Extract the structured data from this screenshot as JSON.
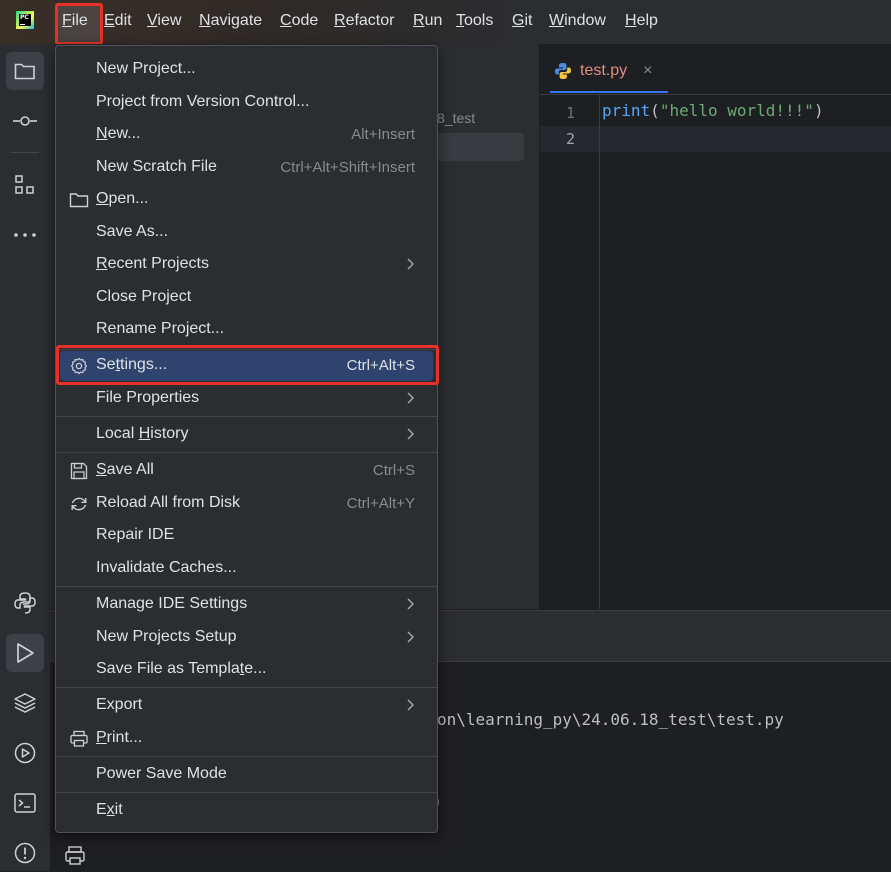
{
  "menubar": {
    "items": [
      "File",
      "Edit",
      "View",
      "Navigate",
      "Code",
      "Refactor",
      "Run",
      "Tools",
      "Git",
      "Window",
      "Help"
    ]
  },
  "project_panel": {
    "peek_text": "8_test"
  },
  "editor": {
    "tab_label": "test.py",
    "tab_close": "×",
    "line_numbers": [
      "1",
      "2"
    ],
    "code_line_1": {
      "fn": "print",
      "open": "(",
      "str": "\"hello world!!!\"",
      "close": ")"
    }
  },
  "console": {
    "path_line": "on\\learning_py\\24.06.18_test\\test.py",
    "exit_fragment": "0"
  },
  "file_menu": {
    "items": [
      {
        "label_pre": "New Project...",
        "label_u": "",
        "label_post": "",
        "shortcut": "",
        "submenu": false,
        "icon": ""
      },
      {
        "label_pre": "Project from Version Control...",
        "label_u": "",
        "label_post": "",
        "shortcut": "",
        "submenu": false,
        "icon": ""
      },
      {
        "label_pre": "",
        "label_u": "N",
        "label_post": "ew...",
        "shortcut": "Alt+Insert",
        "submenu": false,
        "icon": ""
      },
      {
        "label_pre": "New Scratch File",
        "label_u": "",
        "label_post": "",
        "shortcut": "Ctrl+Alt+Shift+Insert",
        "submenu": false,
        "icon": ""
      },
      {
        "label_pre": "",
        "label_u": "O",
        "label_post": "pen...",
        "shortcut": "",
        "submenu": false,
        "icon": "folder-icon"
      },
      {
        "label_pre": "Save As...",
        "label_u": "",
        "label_post": "",
        "shortcut": "",
        "submenu": false,
        "icon": ""
      },
      {
        "label_pre": "",
        "label_u": "R",
        "label_post": "ecent Projects",
        "shortcut": "",
        "submenu": true,
        "icon": ""
      },
      {
        "label_pre": "Close Project",
        "label_u": "",
        "label_post": "",
        "shortcut": "",
        "submenu": false,
        "icon": ""
      },
      {
        "label_pre": "Rename Project...",
        "label_u": "",
        "label_post": "",
        "shortcut": "",
        "submenu": false,
        "icon": ""
      },
      {
        "label_pre": "Se",
        "label_u": "t",
        "label_post": "tings...",
        "shortcut": "Ctrl+Alt+S",
        "submenu": false,
        "icon": "gear-icon"
      },
      {
        "label_pre": "File Properties",
        "label_u": "",
        "label_post": "",
        "shortcut": "",
        "submenu": true,
        "icon": ""
      },
      {
        "label_pre": "Local ",
        "label_u": "H",
        "label_post": "istory",
        "shortcut": "",
        "submenu": true,
        "icon": ""
      },
      {
        "label_pre": "",
        "label_u": "S",
        "label_post": "ave All",
        "shortcut": "Ctrl+S",
        "submenu": false,
        "icon": "save-icon"
      },
      {
        "label_pre": "Reload All from Disk",
        "label_u": "",
        "label_post": "",
        "shortcut": "Ctrl+Alt+Y",
        "submenu": false,
        "icon": "reload-icon"
      },
      {
        "label_pre": "Repair IDE",
        "label_u": "",
        "label_post": "",
        "shortcut": "",
        "submenu": false,
        "icon": ""
      },
      {
        "label_pre": "Invalidate Caches...",
        "label_u": "",
        "label_post": "",
        "shortcut": "",
        "submenu": false,
        "icon": ""
      },
      {
        "label_pre": "Manage IDE Settings",
        "label_u": "",
        "label_post": "",
        "shortcut": "",
        "submenu": true,
        "icon": ""
      },
      {
        "label_pre": "New Projects Setup",
        "label_u": "",
        "label_post": "",
        "shortcut": "",
        "submenu": true,
        "icon": ""
      },
      {
        "label_pre": "Save File as Templa",
        "label_u": "t",
        "label_post": "e...",
        "shortcut": "",
        "submenu": false,
        "icon": ""
      },
      {
        "label_pre": "Export",
        "label_u": "",
        "label_post": "",
        "shortcut": "",
        "submenu": true,
        "icon": ""
      },
      {
        "label_pre": "",
        "label_u": "P",
        "label_post": "rint...",
        "shortcut": "",
        "submenu": false,
        "icon": "printer-icon"
      },
      {
        "label_pre": "Power Save Mode",
        "label_u": "",
        "label_post": "",
        "shortcut": "",
        "submenu": false,
        "icon": ""
      },
      {
        "label_pre": "E",
        "label_u": "x",
        "label_post": "it",
        "shortcut": "",
        "submenu": false,
        "icon": ""
      }
    ]
  },
  "colors": {
    "highlight_box": "#e8302a",
    "selected_item": "#2e436e",
    "accent": "#3574f0"
  }
}
